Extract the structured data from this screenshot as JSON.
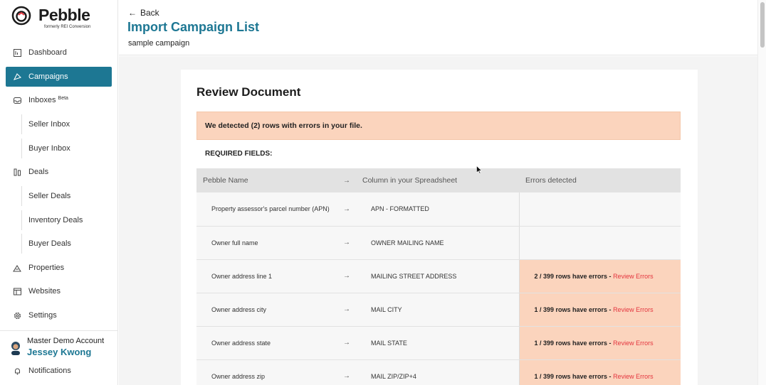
{
  "brand": {
    "name": "Pebble",
    "tagline": "formerly REI Conversion"
  },
  "sidebar": {
    "items": [
      {
        "label": "Dashboard",
        "icon": "dashboard-icon"
      },
      {
        "label": "Campaigns",
        "icon": "campaign-icon",
        "active": true
      },
      {
        "label": "Inboxes",
        "badge": "Beta",
        "icon": "inbox-icon"
      },
      {
        "label": "Seller Inbox",
        "sub": true
      },
      {
        "label": "Buyer Inbox",
        "sub": true
      },
      {
        "label": "Deals",
        "icon": "deals-icon"
      },
      {
        "label": "Seller Deals",
        "sub": true
      },
      {
        "label": "Inventory Deals",
        "sub": true
      },
      {
        "label": "Buyer Deals",
        "sub": true
      },
      {
        "label": "Properties",
        "icon": "properties-icon"
      },
      {
        "label": "Websites",
        "icon": "websites-icon"
      },
      {
        "label": "Settings",
        "icon": "settings-icon"
      }
    ],
    "account": {
      "org": "Master Demo Account",
      "name": "Jessey Kwong"
    },
    "notifications": "Notifications"
  },
  "header": {
    "back": "Back",
    "title": "Import Campaign List",
    "subtitle": "sample campaign"
  },
  "review": {
    "title": "Review Document",
    "alert": "We detected (2) rows with errors in your file.",
    "required_label": "REQUIRED FIELDS:",
    "columns": {
      "pebble": "Pebble Name",
      "spreadsheet": "Column in your Spreadsheet",
      "errors": "Errors detected"
    },
    "review_link": "Review Errors",
    "rows": [
      {
        "pebble": "Property assessor's parcel number (APN)",
        "column": "APN - FORMATTED",
        "errors": ""
      },
      {
        "pebble": "Owner full name",
        "column": "OWNER MAILING NAME",
        "errors": ""
      },
      {
        "pebble": "Owner address line 1",
        "column": "MAILING STREET ADDRESS",
        "errors": "2 / 399 rows have errors - "
      },
      {
        "pebble": "Owner address city",
        "column": "MAIL CITY",
        "errors": "1 / 399 rows have errors - "
      },
      {
        "pebble": "Owner address state",
        "column": "MAIL STATE",
        "errors": "1 / 399 rows have errors - "
      },
      {
        "pebble": "Owner address zip",
        "column": "MAIL ZIP/ZIP+4",
        "errors": "1 / 399 rows have errors - "
      }
    ]
  },
  "colors": {
    "accent": "#1d7793",
    "error_bg": "#fbd4bd",
    "error_link": "#e4363f"
  }
}
